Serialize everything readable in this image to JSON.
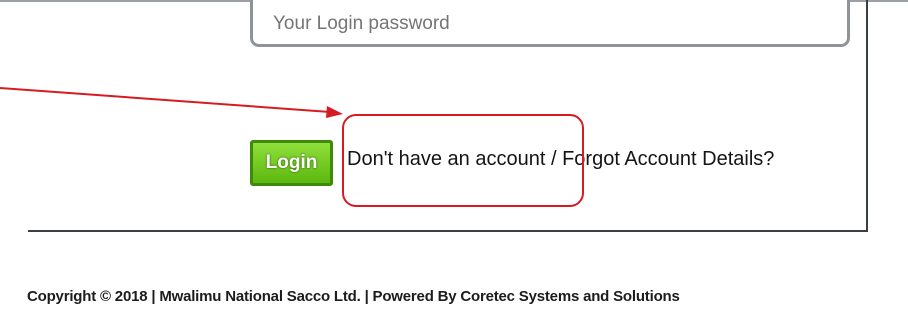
{
  "password_field": {
    "placeholder": "Your Login password"
  },
  "login_button": {
    "label": "Login"
  },
  "account_link": {
    "text": "Don't have an account / Forgot Account Details?"
  },
  "annotation": {
    "color": "#d61c22"
  },
  "footer": {
    "copyright": "Copyright © 2018 | Mwalimu National Sacco Ltd. | Powered By Coretec Systems and Solutions"
  },
  "colors": {
    "login_button_green": "#6cc41c",
    "frame_border": "#3a3f44"
  }
}
